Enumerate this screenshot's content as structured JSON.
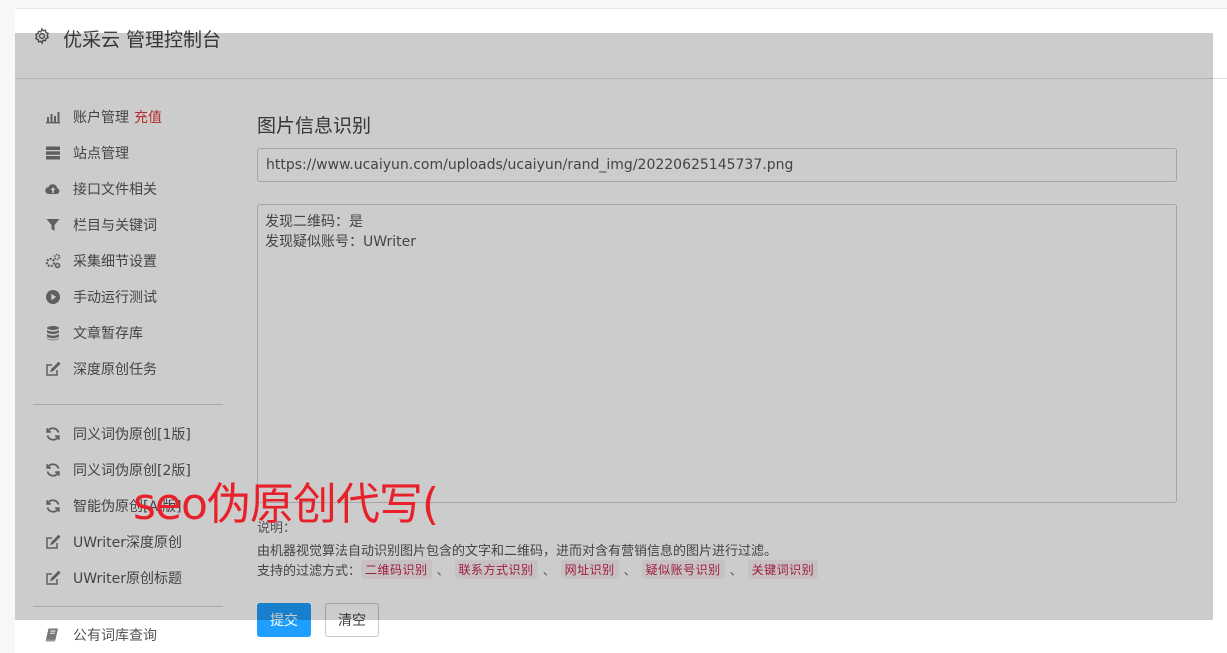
{
  "header": {
    "title": "优采云 管理控制台",
    "icon": "gear-icon"
  },
  "sidebar": {
    "items": [
      {
        "label": "账户管理",
        "badge": "充值",
        "icon": "bar-chart-icon"
      },
      {
        "label": "站点管理",
        "icon": "server-icon"
      },
      {
        "label": "接口文件相关",
        "icon": "cloud-upload-icon"
      },
      {
        "label": "栏目与关键词",
        "icon": "filter-icon"
      },
      {
        "label": "采集细节设置",
        "icon": "cogs-icon"
      },
      {
        "label": "手动运行测试",
        "icon": "play-circle-icon"
      },
      {
        "label": "文章暂存库",
        "icon": "database-icon"
      },
      {
        "label": "深度原创任务",
        "icon": "edit-icon"
      },
      {
        "label": "同义词伪原创[1版]",
        "icon": "refresh-icon"
      },
      {
        "label": "同义词伪原创[2版]",
        "icon": "refresh-icon"
      },
      {
        "label": "智能伪原创[AI版]",
        "icon": "refresh-icon"
      },
      {
        "label": "UWriter深度原创",
        "icon": "edit-icon"
      },
      {
        "label": "UWriter原创标题",
        "icon": "edit-icon"
      },
      {
        "label": "公有词库查询",
        "icon": "book-icon"
      }
    ]
  },
  "main": {
    "title": "图片信息识别",
    "url_value": "https://www.ucaiyun.com/uploads/ucaiyun/rand_img/20220625145737.png",
    "result_lines": [
      "发现二维码：是",
      "发现疑似账号：UWriter"
    ],
    "desc_label": "说明：",
    "desc_text": "由机器视觉算法自动识别图片包含的文字和二维码，进而对含有营销信息的图片进行过滤。",
    "filter_label": "支持的过滤方式：",
    "filter_tags": [
      "二维码识别",
      "联系方式识别",
      "网址识别",
      "疑似账号识别",
      "关键词识别"
    ],
    "filter_sep": "、",
    "submit_label": "提交",
    "clear_label": "清空"
  },
  "watermark": "seo伪原创代写(",
  "colors": {
    "accent": "#1e9fff",
    "recharge": "#e4393c",
    "tag_text": "#c7254e",
    "tag_bg": "#f9f2f4",
    "watermark": "#e8202a"
  }
}
